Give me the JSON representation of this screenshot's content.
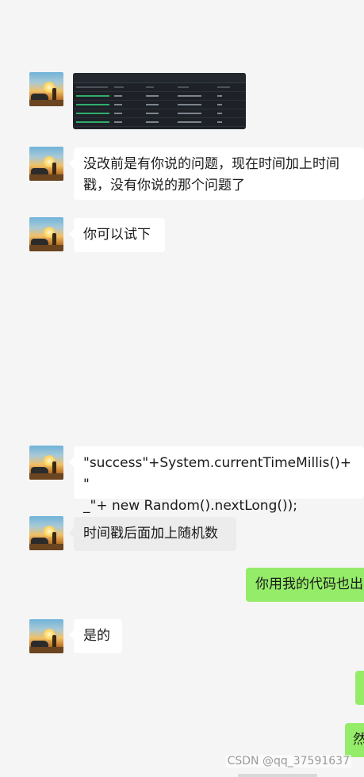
{
  "messages": [
    {
      "side": "left",
      "type": "image"
    },
    {
      "side": "left",
      "type": "text",
      "text": "没改前是有你说的问题，现在时间加上时间\n戳，没有你说的那个问题了"
    },
    {
      "side": "left",
      "type": "text",
      "text": "你可以试下"
    },
    {
      "side": "left",
      "type": "text",
      "text": "\"success\"+System.currentTimeMillis()+ \"\n_\"+ new Random().nextLong());"
    },
    {
      "side": "left",
      "type": "text",
      "text": "时间戳后面加上随机数"
    },
    {
      "side": "right",
      "type": "text",
      "text": "你用我的代码也出"
    },
    {
      "side": "left",
      "type": "text",
      "text": "是的"
    },
    {
      "side": "right",
      "type": "text",
      "text": ""
    },
    {
      "side": "right",
      "type": "text",
      "text": "然"
    }
  ],
  "watermark": "CSDN @qq_37591637",
  "colors": {
    "background": "#f5f5f5",
    "bubble_left": "#ffffff",
    "bubble_right": "#95ec69"
  }
}
